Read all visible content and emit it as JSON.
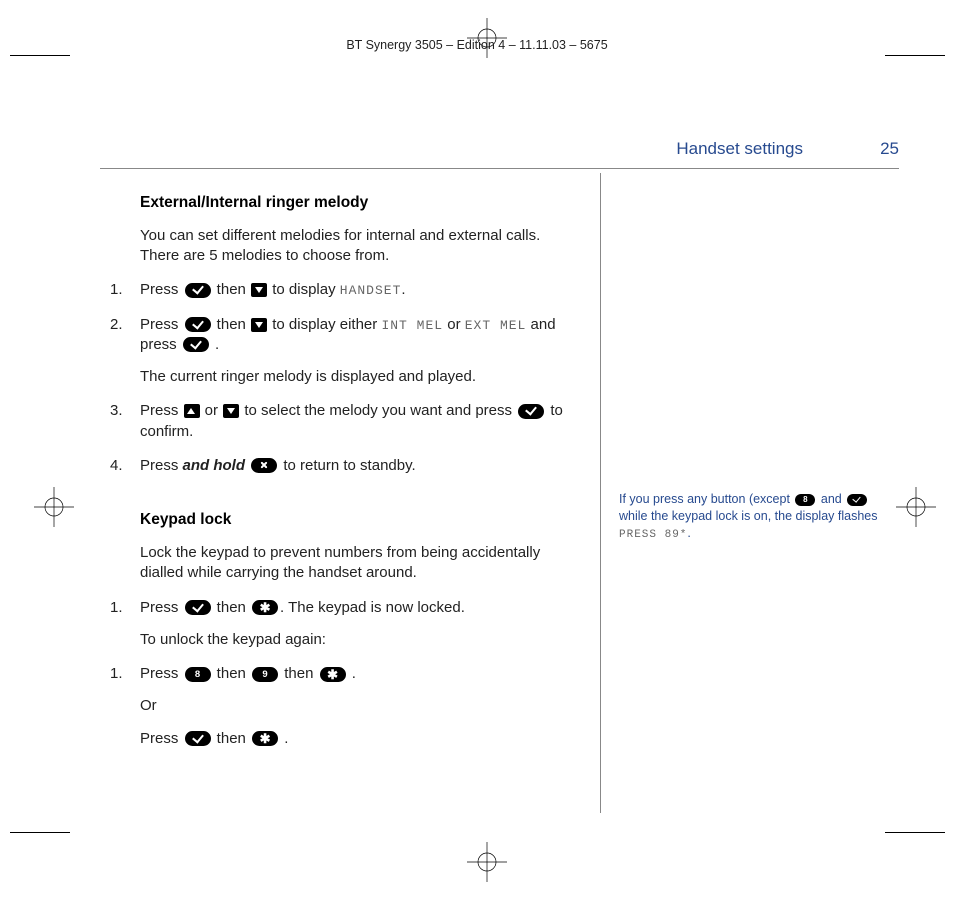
{
  "header": "BT Synergy 3505 – Edition 4 – 11.11.03 – 5675",
  "section_title": "Handset settings",
  "page_number": "25",
  "ringer": {
    "heading": "External/Internal ringer melody",
    "intro": "You can set different melodies for internal and external calls. There are 5 melodies to choose from.",
    "step1_a": "Press ",
    "step1_b": " then ",
    "step1_c": " to display ",
    "step1_lcd": "HANDSET",
    "step1_d": ".",
    "step2_a": "Press ",
    "step2_b": " then ",
    "step2_c": " to display either ",
    "step2_lcd1": "INT MEL",
    "step2_d": " or ",
    "step2_lcd2": "EXT MEL",
    "step2_e": " and press ",
    "step2_f": " .",
    "step2_note": "The current ringer melody is displayed and played.",
    "step3_a": "Press ",
    "step3_b": " or ",
    "step3_c": " to select the melody you want and press ",
    "step3_d": " to confirm.",
    "step4_a": "Press ",
    "step4_hold": "and hold",
    "step4_b": " to return to standby."
  },
  "keypad": {
    "heading": "Keypad lock",
    "intro": "Lock the keypad to prevent numbers from being accidentally dialled while carrying the handset around.",
    "lock1_a": "Press ",
    "lock1_b": " then ",
    "lock1_c": ". The keypad is now locked.",
    "unlock_label": "To unlock the keypad again:",
    "unlock1_a": "Press ",
    "unlock1_b": " then ",
    "unlock1_c": " then ",
    "unlock1_d": " .",
    "or": "Or",
    "unlock2_a": "Press ",
    "unlock2_b": " then ",
    "unlock2_c": " ."
  },
  "side": {
    "a": "If you press any button (except ",
    "b": " and ",
    "c": " while the keypad lock is on, the display flashes ",
    "lcd": "PRESS 89*",
    "d": "."
  },
  "keys": {
    "eight": "8",
    "nine": "9",
    "star": "✱"
  }
}
